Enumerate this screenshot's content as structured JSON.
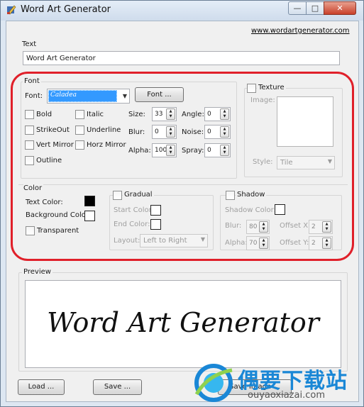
{
  "window": {
    "title": "Word Art Generator",
    "min_glyph": "—",
    "max_glyph": "□",
    "close_glyph": "✕"
  },
  "link": "www.wordartgenerator.com",
  "text_group": {
    "title": "Text",
    "value": "Word Art Generator"
  },
  "font_group": {
    "title": "Font",
    "font_label": "Font:",
    "font_value": "Caladea",
    "font_button": "Font ...",
    "checkboxes": {
      "bold": "Bold",
      "italic": "Italic",
      "strikeout": "StrikeOut",
      "underline": "Underline",
      "vert_mirror": "Vert Mirror",
      "horz_mirror": "Horz Mirror",
      "outline": "Outline"
    },
    "size": {
      "label": "Size:",
      "value": "33"
    },
    "blur": {
      "label": "Blur:",
      "value": "0"
    },
    "alpha": {
      "label": "Alpha:",
      "value": "100"
    },
    "angle": {
      "label": "Angle:",
      "value": "0"
    },
    "noise": {
      "label": "Noise:",
      "value": "0"
    },
    "spray": {
      "label": "Spray:",
      "value": "0"
    }
  },
  "texture_group": {
    "title": "Texture",
    "image_label": "Image:",
    "style_label": "Style:",
    "style_value": "Tile"
  },
  "color_group": {
    "title": "Color",
    "text_color": "Text Color:",
    "background_color": "Background Color",
    "transparent": "Transparent",
    "text_color_hex": "#000000",
    "background_color_hex": "#ffffff"
  },
  "gradual_group": {
    "title": "Gradual",
    "start_color": "Start Color:",
    "end_color": "End Color:",
    "layout_label": "Layout:",
    "layout_value": "Left to Right"
  },
  "shadow_group": {
    "title": "Shadow",
    "shadow_color": "Shadow Color:",
    "blur_label": "Blur:",
    "blur_value": "80",
    "alpha_label": "Alpha:",
    "alpha_value": "70",
    "offset_x_label": "Offset X:",
    "offset_x_value": "2",
    "offset_y_label": "Offset Y:",
    "offset_y_value": "2"
  },
  "preview_group": {
    "title": "Preview",
    "text": "Word Art Generator"
  },
  "buttons": {
    "load": "Load ...",
    "save": "Save ...",
    "save_image": "Save Image ..."
  },
  "watermark": {
    "chinese": "偶要下载站",
    "url": "ouyaoxiazai.com"
  },
  "highlight_color": "#e0202a"
}
